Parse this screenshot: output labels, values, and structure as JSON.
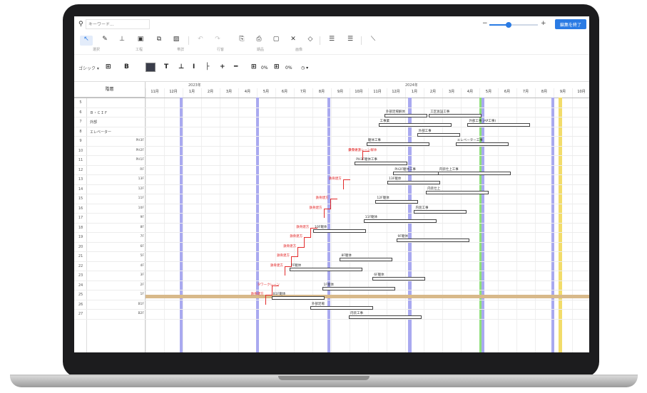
{
  "search": {
    "placeholder": "キーワード..."
  },
  "zoom": {
    "minus": "−",
    "plus": "+",
    "level": 0.4
  },
  "end_edit_label": "編集を終了",
  "toolbar1": {
    "tools": [
      "↖",
      "✎",
      "⊥",
      "▣",
      "⧉",
      "▨",
      "↶",
      "↷",
      "⎘",
      "⎙",
      "▢",
      "✕",
      "◇",
      "☰",
      "☰",
      "⟍"
    ],
    "labels": [
      "選択",
      "工程",
      "帯詳",
      "行客",
      "期品",
      "画像"
    ]
  },
  "toolbar2": {
    "font": "ゴシック ▾",
    "bold": "B",
    "glyphs": [
      "T",
      "⊥",
      "I",
      "├",
      "+",
      "━"
    ],
    "pcts": [
      "0%",
      "0%"
    ],
    "clock": "◷ ▾"
  },
  "chart": {
    "header_label": "階層",
    "years": [
      "2023年",
      "2024年"
    ],
    "months": [
      "11月",
      "12月",
      "1月",
      "2月",
      "3月",
      "4月",
      "5月",
      "6月",
      "7月",
      "8月",
      "9月",
      "10月",
      "11月",
      "12月",
      "1月",
      "2月",
      "3月",
      "4月",
      "5月",
      "6月",
      "7月",
      "8月",
      "9月",
      "10月"
    ],
    "rows": [
      {
        "n": "5",
        "label": "",
        "floor": ""
      },
      {
        "n": "6",
        "label": "Ｂ・ＣＩＦ",
        "floor": ""
      },
      {
        "n": "7",
        "label": "外部",
        "floor": ""
      },
      {
        "n": "8",
        "label": "エレベーター",
        "floor": ""
      },
      {
        "n": "9",
        "label": "",
        "floor": "PH3F"
      },
      {
        "n": "10",
        "label": "",
        "floor": "PH2F"
      },
      {
        "n": "11",
        "label": "",
        "floor": "PH1F"
      },
      {
        "n": "12",
        "label": "",
        "floor": "RF"
      },
      {
        "n": "13",
        "label": "",
        "floor": "13F"
      },
      {
        "n": "14",
        "label": "",
        "floor": "12F"
      },
      {
        "n": "15",
        "label": "",
        "floor": "11F"
      },
      {
        "n": "16",
        "label": "",
        "floor": "10F"
      },
      {
        "n": "17",
        "label": "",
        "floor": "9F"
      },
      {
        "n": "18",
        "label": "",
        "floor": "8F"
      },
      {
        "n": "19",
        "label": "",
        "floor": "7F"
      },
      {
        "n": "20",
        "label": "",
        "floor": "6F"
      },
      {
        "n": "21",
        "label": "",
        "floor": "5F"
      },
      {
        "n": "22",
        "label": "",
        "floor": "4F"
      },
      {
        "n": "23",
        "label": "",
        "floor": "3F"
      },
      {
        "n": "24",
        "label": "",
        "floor": "2F"
      },
      {
        "n": "25",
        "label": "",
        "floor": "1F"
      },
      {
        "n": "26",
        "label": "",
        "floor": "B1F"
      },
      {
        "n": "27",
        "label": "",
        "floor": "B2F"
      }
    ],
    "bars": [
      {
        "label": "外部足場解体",
        "red": false
      },
      {
        "label": "工区仮設工事",
        "red": false
      },
      {
        "label": "外部工事 (AP工事)",
        "red": false
      },
      {
        "label": "工事業",
        "red": false
      },
      {
        "label": "外部工事",
        "red": false
      },
      {
        "label": "エレベーター工事",
        "red": false
      },
      {
        "label": "躯体工事",
        "red": false
      },
      {
        "label": "鉄骨建方",
        "red": true
      },
      {
        "label": "タワークレーン解体",
        "red": true
      },
      {
        "label": "PH3F躯体工事",
        "red": false
      },
      {
        "label": "PH2F躯体工事",
        "red": false
      },
      {
        "label": "内装仕上工事",
        "red": false
      },
      {
        "label": "鉄骨建方",
        "red": true
      },
      {
        "label": "13F躯体",
        "red": false
      },
      {
        "label": "内装仕上",
        "red": false
      },
      {
        "label": "鉄骨建方",
        "red": true
      },
      {
        "label": "12F躯体",
        "red": false
      },
      {
        "label": "内装工事",
        "red": false
      },
      {
        "label": "鉄骨建方",
        "red": true
      },
      {
        "label": "11F躯体",
        "red": false
      },
      {
        "label": "鉄骨建方",
        "red": true
      },
      {
        "label": "10F躯体",
        "red": false
      },
      {
        "label": "鉄骨建方",
        "red": true
      },
      {
        "label": "9F躯体",
        "red": false
      },
      {
        "label": "鉄骨建方",
        "red": true
      },
      {
        "label": "8F躯体",
        "red": false
      },
      {
        "label": "鉄骨建方",
        "red": true
      },
      {
        "label": "7F躯体",
        "red": false
      },
      {
        "label": "鉄骨建方",
        "red": true
      },
      {
        "label": "6F躯体",
        "red": false
      },
      {
        "label": "タワークレーン",
        "red": true
      },
      {
        "label": "1F躯体",
        "red": false
      },
      {
        "label": "鉄骨建方",
        "red": true
      },
      {
        "label": "B1F躯体",
        "red": false
      },
      {
        "label": "外部足場",
        "red": false
      },
      {
        "label": "内装工事",
        "red": false
      }
    ]
  },
  "colors": {
    "accent": "#2a7be4",
    "band": "#a9a9f0",
    "green": "#8fe07a",
    "yellow": "#f2dc6a",
    "red": "#e32b2b"
  }
}
